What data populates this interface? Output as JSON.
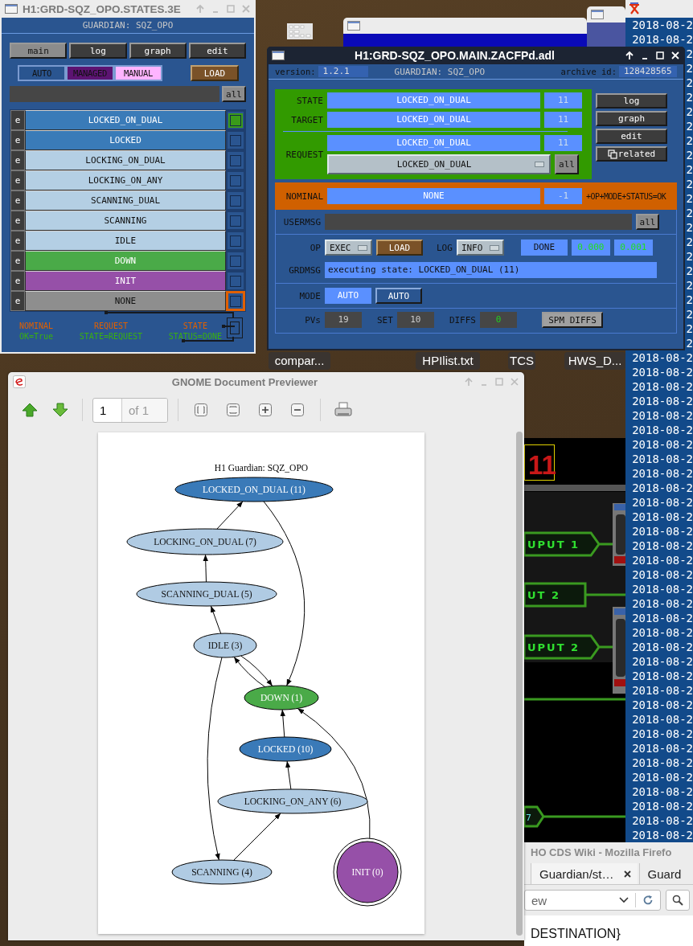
{
  "desktop": {
    "icon_labels": [
      "compar...",
      "HPIlist.txt",
      "TCS",
      "HWS_D..."
    ]
  },
  "timestamps": [
    "2018-08-2",
    "2018-08-2",
    "2",
    "2",
    "2",
    "2",
    "2",
    "2",
    "2",
    "2",
    "2",
    "2",
    "2",
    "2",
    "2",
    "2",
    "2",
    "2",
    "2",
    "2",
    "2",
    "2",
    "2",
    "2018-08-2",
    "2018-08-2",
    "2018-08-2",
    "2018-08-2",
    "2018-08-2",
    "2018-08-2",
    "2018-08-2",
    "2018-08-2",
    "2018-08-2",
    "2018-08-2",
    "2018-08-2",
    "2018-08-2",
    "2018-08-2",
    "2018-08-2",
    "2018-08-2",
    "2018-08-2",
    "2018-08-2",
    "2018-08-2",
    "2018-08-2",
    "2018-08-2",
    "2018-08-2",
    "2018-08-2",
    "2018-08-2",
    "2018-08-2",
    "2018-08-2",
    "2018-08-2",
    "2018-08-2",
    "2018-08-2",
    "2018-08-2",
    "2018-08-2",
    "2018-08-2",
    "2018-08-2",
    "2018-08-2",
    "2018-08-2"
  ],
  "states_window": {
    "title": "H1:GRD-SQZ_OPO.STATES.3E",
    "guardian": "GUARDIAN: SQZ_OPO",
    "nav_buttons": [
      {
        "label": "main",
        "selected": true
      },
      {
        "label": "log",
        "selected": false
      },
      {
        "label": "graph",
        "selected": false
      },
      {
        "label": "edit",
        "selected": false
      }
    ],
    "modes": [
      {
        "label": "AUTO",
        "color": "#2a5590"
      },
      {
        "label": "MANAGED",
        "color": "#5c1472"
      },
      {
        "label": "MANUAL",
        "color": "#ffb4ff"
      }
    ],
    "load": "LOAD",
    "all": "all",
    "states": [
      {
        "edit": "e",
        "label": "LOCKED_ON_DUAL",
        "color": "#3a7bb8",
        "current": true,
        "nominal": false
      },
      {
        "edit": "e",
        "label": "LOCKED",
        "color": "#3a7bb8",
        "current": false,
        "nominal": false
      },
      {
        "edit": "e",
        "label": "LOCKING_ON_DUAL",
        "color": "#b4cfe4",
        "current": false,
        "nominal": false
      },
      {
        "edit": "e",
        "label": "LOCKING_ON_ANY",
        "color": "#b4cfe4",
        "current": false,
        "nominal": false
      },
      {
        "edit": "e",
        "label": "SCANNING_DUAL",
        "color": "#b4cfe4",
        "current": false,
        "nominal": false
      },
      {
        "edit": "e",
        "label": "SCANNING",
        "color": "#b4cfe4",
        "current": false,
        "nominal": false
      },
      {
        "edit": "e",
        "label": "IDLE",
        "color": "#b4cfe4",
        "current": false,
        "nominal": false
      },
      {
        "edit": "e",
        "label": "DOWN",
        "color": "#4aaa48",
        "current": false,
        "nominal": false
      },
      {
        "edit": "e",
        "label": "INIT",
        "color": "#9650a8",
        "current": false,
        "nominal": false
      },
      {
        "edit": "e",
        "label": "NONE",
        "color": "#8e8e8e",
        "current": false,
        "nominal": true
      }
    ],
    "legend": [
      {
        "label": "NOMINAL",
        "status": "OK=True"
      },
      {
        "label": "REQUEST",
        "status": "STATE=REQUEST"
      },
      {
        "label": "STATE",
        "status": "STATUS=DONE"
      }
    ]
  },
  "main_window": {
    "title": "H1:GRD-SQZ_OPO.MAIN.ZACFPd.adl",
    "version_label": "version:",
    "version": "1.2.1",
    "guardian": "GUARDIAN: SQZ_OPO",
    "archive_label": "archive id:",
    "archive_id": "128428565",
    "state": {
      "label": "STATE",
      "value": "LOCKED_ON_DUAL",
      "index": "11"
    },
    "target": {
      "label": "TARGET",
      "value": "LOCKED_ON_DUAL",
      "index": "11"
    },
    "request": {
      "label": "REQUEST",
      "value": "LOCKED_ON_DUAL",
      "index": "11",
      "menu": "LOCKED_ON_DUAL",
      "all": "all"
    },
    "side_buttons": [
      {
        "label": "log",
        "kind": "plain"
      },
      {
        "label": "graph",
        "kind": "plain"
      },
      {
        "label": "edit",
        "kind": "plain"
      },
      {
        "label": "related",
        "kind": "related"
      }
    ],
    "nominal": {
      "label": "NOMINAL",
      "value": "NONE",
      "index": "-1",
      "status": "+OP+MODE+STATUS=OK"
    },
    "usermsg": {
      "label": "USERMSG",
      "all": "all"
    },
    "op": {
      "label": "OP",
      "value": "EXEC",
      "load": "LOAD",
      "log_label": "LOG",
      "log_value": "INFO",
      "status": "DONE",
      "timers": [
        "0.000",
        "0.001"
      ]
    },
    "grdmsg": {
      "label": "GRDMSG",
      "text": "executing state: LOCKED_ON_DUAL (11)"
    },
    "mode": {
      "label": "MODE",
      "value": "AUTO",
      "button": "AUTO"
    },
    "counts": [
      {
        "label": "PVs",
        "value": "19",
        "kind": "plain"
      },
      {
        "label": "SET",
        "value": "10",
        "kind": "plain"
      },
      {
        "label": "DIFFS",
        "value": "0",
        "kind": "diff"
      }
    ],
    "spm_diffs": "SPM DIFFS"
  },
  "previewer": {
    "title": "GNOME Document Previewer",
    "page": "1",
    "page_count": "of 1",
    "graph": {
      "title": "H1 Guardian: SQZ_OPO",
      "nodes": [
        {
          "label": "LOCKED_ON_DUAL (11)",
          "color": "#3a7ab8",
          "kind": "ellipse"
        },
        {
          "label": "LOCKING_ON_DUAL (7)",
          "color": "#b0cbe3",
          "kind": "ellipse"
        },
        {
          "label": "SCANNING_DUAL (5)",
          "color": "#b0cbe3",
          "kind": "ellipse"
        },
        {
          "label": "IDLE (3)",
          "color": "#b0cbe3",
          "kind": "ellipse"
        },
        {
          "label": "DOWN (1)",
          "color": "#4aaa48",
          "kind": "ellipse"
        },
        {
          "label": "LOCKED (10)",
          "color": "#3a7ab8",
          "kind": "ellipse"
        },
        {
          "label": "LOCKING_ON_ANY (6)",
          "color": "#b0cbe3",
          "kind": "ellipse"
        },
        {
          "label": "SCANNING (4)",
          "color": "#b0cbe3",
          "kind": "ellipse"
        },
        {
          "label": "INIT (0)",
          "color": "#9650a8",
          "kind": "doublecircle"
        }
      ]
    }
  },
  "circuit_panel": {
    "digits": "11",
    "labels": [
      "UPUT 1",
      "UT 2",
      "UPUT 2"
    ],
    "tag": "7"
  },
  "firefox": {
    "title": "HO CDS Wiki - Mozilla Firefo",
    "tabs": [
      {
        "label": "Guardian/st…",
        "selected": true
      },
      {
        "label": "Guard",
        "selected": false
      }
    ],
    "url": "ew",
    "page_text": "DESTINATION}"
  }
}
